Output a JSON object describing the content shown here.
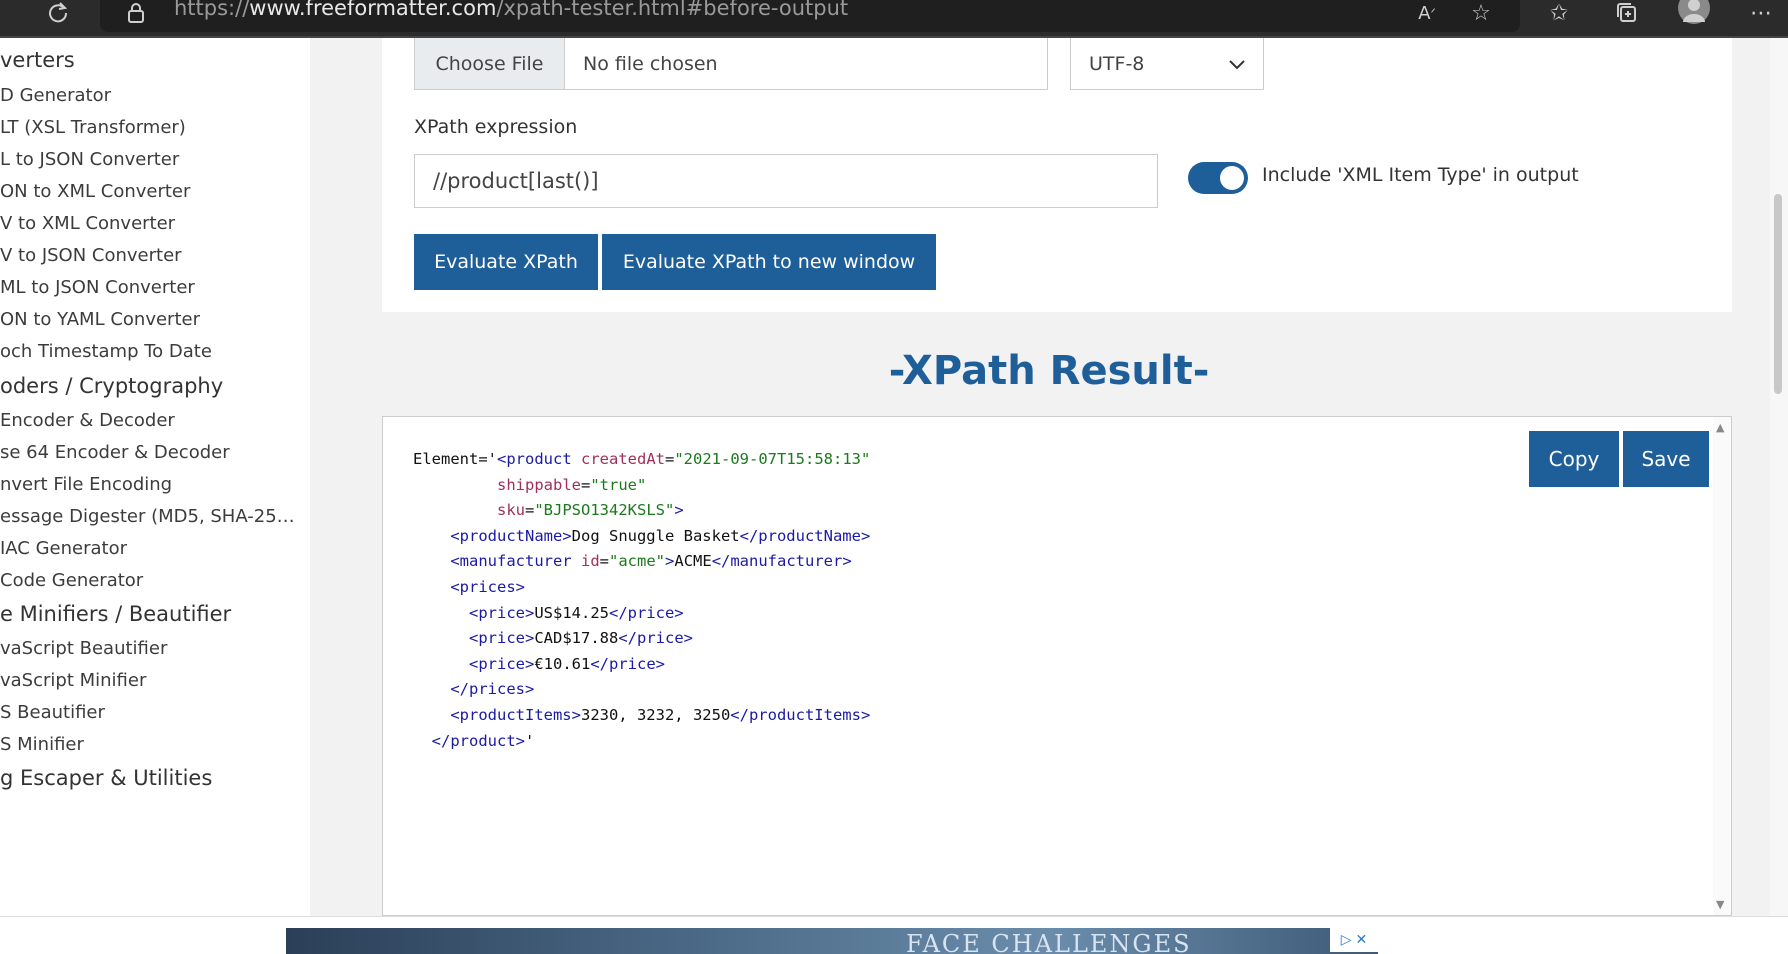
{
  "browser": {
    "url_scheme": "https://",
    "url_host": "www.freeformatter.com",
    "url_path": "/xpath-tester.html#before-output",
    "icons": [
      "refresh-icon",
      "lock-icon",
      "read-aloud-icon",
      "add-favorite-icon",
      "favorites-icon",
      "collections-icon",
      "profile-icon",
      "more-icon"
    ]
  },
  "sidebar": {
    "items": [
      {
        "label": "verters",
        "kind": "header"
      },
      {
        "label": "D Generator",
        "kind": "sub"
      },
      {
        "label": "LT (XSL Transformer)",
        "kind": "sub"
      },
      {
        "label": "L to JSON Converter",
        "kind": "sub"
      },
      {
        "label": "ON to XML Converter",
        "kind": "sub"
      },
      {
        "label": "V to XML Converter",
        "kind": "sub"
      },
      {
        "label": "V to JSON Converter",
        "kind": "sub"
      },
      {
        "label": "ML to JSON Converter",
        "kind": "sub"
      },
      {
        "label": "ON to YAML Converter",
        "kind": "sub"
      },
      {
        "label": "och Timestamp To Date",
        "kind": "sub"
      },
      {
        "label": "oders / Cryptography",
        "kind": "header"
      },
      {
        "label": " Encoder & Decoder",
        "kind": "sub"
      },
      {
        "label": "se 64 Encoder & Decoder",
        "kind": "sub"
      },
      {
        "label": "nvert File Encoding",
        "kind": "sub"
      },
      {
        "label": "essage Digester (MD5, SHA-25…",
        "kind": "sub"
      },
      {
        "label": "IAC Generator",
        "kind": "sub"
      },
      {
        "label": " Code Generator",
        "kind": "sub"
      },
      {
        "label": "e Minifiers / Beautifier",
        "kind": "header"
      },
      {
        "label": "vaScript Beautifier",
        "kind": "sub"
      },
      {
        "label": "vaScript Minifier",
        "kind": "sub"
      },
      {
        "label": "S Beautifier",
        "kind": "sub"
      },
      {
        "label": "S Minifier",
        "kind": "sub"
      },
      {
        "label": "g Escaper & Utilities",
        "kind": "header"
      }
    ]
  },
  "form": {
    "file_button": "Choose File",
    "file_status": "No file chosen",
    "encoding": "UTF-8",
    "xpath_label": "XPath expression",
    "xpath_value": "//product[last()]",
    "include_toggle_on": true,
    "include_label": "Include 'XML Item Type' in output",
    "evaluate_button": "Evaluate XPath",
    "evaluate_new_button": "Evaluate XPath to new window"
  },
  "result": {
    "title": "-XPath Result-",
    "copy_button": "Copy",
    "save_button": "Save",
    "lines": [
      [
        {
          "t": "plain",
          "s": "Element='"
        },
        {
          "t": "tag",
          "s": "<product"
        },
        {
          "t": "plain",
          "s": " "
        },
        {
          "t": "attr",
          "s": "createdAt"
        },
        {
          "t": "plain",
          "s": "="
        },
        {
          "t": "val",
          "s": "\"2021-09-07T15:58:13\""
        }
      ],
      [
        {
          "t": "plain",
          "s": "         "
        },
        {
          "t": "attr",
          "s": "shippable"
        },
        {
          "t": "plain",
          "s": "="
        },
        {
          "t": "val",
          "s": "\"true\""
        }
      ],
      [
        {
          "t": "plain",
          "s": "         "
        },
        {
          "t": "attr",
          "s": "sku"
        },
        {
          "t": "plain",
          "s": "="
        },
        {
          "t": "val",
          "s": "\"BJPSO1342KSLS\""
        },
        {
          "t": "tag",
          "s": ">"
        }
      ],
      [
        {
          "t": "plain",
          "s": "    "
        },
        {
          "t": "tag",
          "s": "<productName>"
        },
        {
          "t": "plain",
          "s": "Dog Snuggle Basket"
        },
        {
          "t": "tag",
          "s": "</productName>"
        }
      ],
      [
        {
          "t": "plain",
          "s": "    "
        },
        {
          "t": "tag",
          "s": "<manufacturer"
        },
        {
          "t": "plain",
          "s": " "
        },
        {
          "t": "attr",
          "s": "id"
        },
        {
          "t": "plain",
          "s": "="
        },
        {
          "t": "val",
          "s": "\"acme\""
        },
        {
          "t": "tag",
          "s": ">"
        },
        {
          "t": "plain",
          "s": "ACME"
        },
        {
          "t": "tag",
          "s": "</manufacturer>"
        }
      ],
      [
        {
          "t": "plain",
          "s": "    "
        },
        {
          "t": "tag",
          "s": "<prices>"
        }
      ],
      [
        {
          "t": "plain",
          "s": "      "
        },
        {
          "t": "tag",
          "s": "<price>"
        },
        {
          "t": "plain",
          "s": "US$14.25"
        },
        {
          "t": "tag",
          "s": "</price>"
        }
      ],
      [
        {
          "t": "plain",
          "s": "      "
        },
        {
          "t": "tag",
          "s": "<price>"
        },
        {
          "t": "plain",
          "s": "CAD$17.88"
        },
        {
          "t": "tag",
          "s": "</price>"
        }
      ],
      [
        {
          "t": "plain",
          "s": "      "
        },
        {
          "t": "tag",
          "s": "<price>"
        },
        {
          "t": "plain",
          "s": "€10.61"
        },
        {
          "t": "tag",
          "s": "</price>"
        }
      ],
      [
        {
          "t": "plain",
          "s": "    "
        },
        {
          "t": "tag",
          "s": "</prices>"
        }
      ],
      [
        {
          "t": "plain",
          "s": "    "
        },
        {
          "t": "tag",
          "s": "<productItems>"
        },
        {
          "t": "plain",
          "s": "3230, 3232, 3250"
        },
        {
          "t": "tag",
          "s": "</productItems>"
        }
      ],
      [
        {
          "t": "plain",
          "s": "  "
        },
        {
          "t": "tag",
          "s": "</product>"
        },
        {
          "t": "plain",
          "s": "'"
        }
      ]
    ]
  },
  "ad": {
    "text": "FACE CHALLENGES"
  },
  "colors": {
    "accent": "#1f5f99",
    "tag": "#1a1aa6",
    "attr": "#a0305a",
    "value": "#1b7a1b"
  }
}
